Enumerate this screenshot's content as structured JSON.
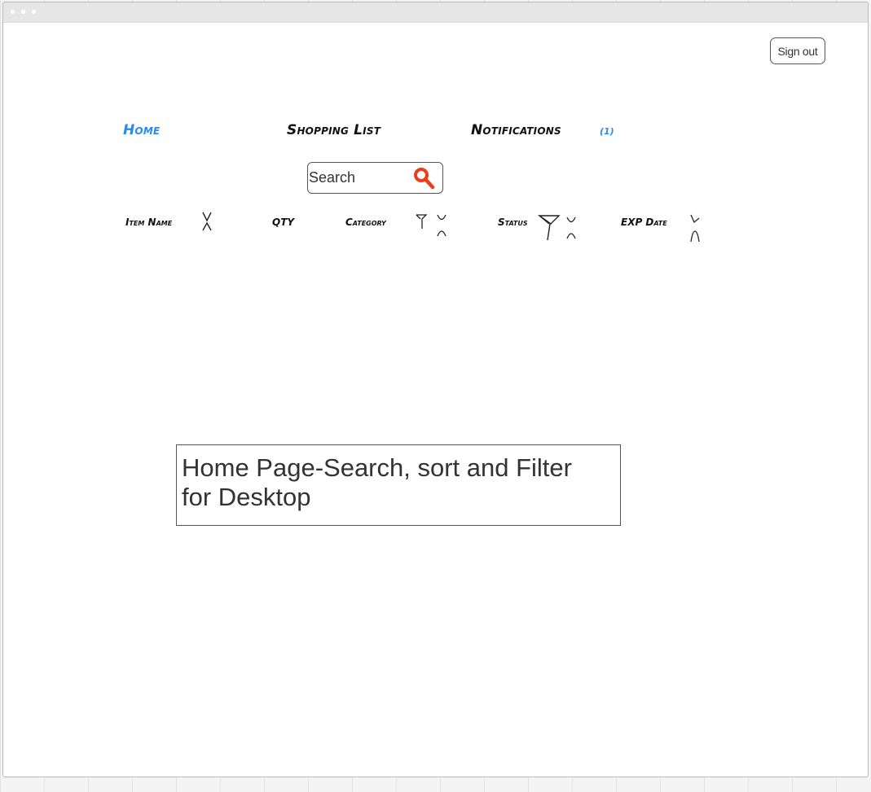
{
  "header": {
    "signout_label": "Sign out"
  },
  "nav": {
    "items": [
      {
        "label": "Home",
        "active": true
      },
      {
        "label": "Shopping List",
        "active": false
      },
      {
        "label": "Notifications",
        "active": false
      }
    ],
    "notification_count": "(1)"
  },
  "search": {
    "placeholder": "Search",
    "value": ""
  },
  "table": {
    "columns": [
      {
        "label": "Item Name",
        "sortable": true,
        "filterable": false
      },
      {
        "label": "QTY",
        "sortable": false,
        "filterable": false
      },
      {
        "label": "Category",
        "sortable": true,
        "filterable": true
      },
      {
        "label": "Status",
        "sortable": true,
        "filterable": true
      },
      {
        "label": "EXP Date",
        "sortable": true,
        "filterable": false
      }
    ]
  },
  "caption": {
    "text": "Home Page-Search, sort and Filter for Desktop"
  },
  "colors": {
    "active_nav": "#2a8af0",
    "search_icon": "#e8401c",
    "border": "#555555"
  },
  "icons": {
    "search": "magnifier-icon",
    "sort": "sort-arrows-icon",
    "filter": "funnel-icon"
  }
}
